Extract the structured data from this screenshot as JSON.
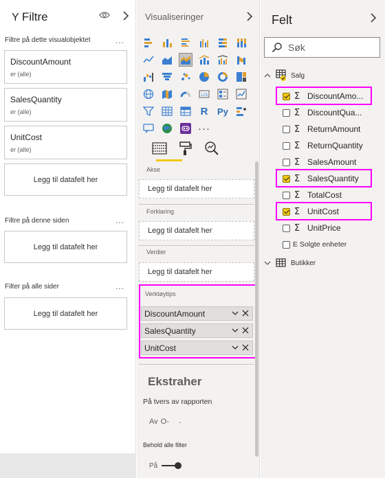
{
  "filters": {
    "title": "Filtre",
    "visual_section": "Filtre på dette visualobjektet",
    "page_section": "Filtre på denne siden",
    "all_section": "Filter på alle sider",
    "more": "...",
    "cards": [
      {
        "name": "DiscountAmount",
        "sub": "er (alle)"
      },
      {
        "name": "SalesQuantity",
        "sub": "er (alle)"
      },
      {
        "name": "UnitCost",
        "sub": "er (alle)"
      }
    ],
    "add_field": "Legg til datafelt her"
  },
  "visualizations": {
    "title": "Visualiseringer",
    "more_visuals": "···",
    "wells": {
      "axis": "Akse",
      "legend": "Forklaring",
      "values": "Verdier",
      "tooltips": "Verktøytips",
      "add_field": "Legg til datafelt her"
    },
    "tooltip_fields": [
      "DiscountAmount",
      "SalesQuantity",
      "UnitCost"
    ],
    "drillthrough": {
      "title": "Ekstraher",
      "cross_report": "På tvers av rapporten",
      "off_label": "Av",
      "off_symbol": "O-",
      "dot": "·",
      "keep_all": "Behold alle filter",
      "on_label": "På"
    },
    "icons": {
      "r": "R",
      "py": "Py"
    }
  },
  "fields": {
    "title": "Felt",
    "search_placeholder": "Søk",
    "tables": [
      {
        "name": "Salg",
        "expanded": true,
        "fields": [
          {
            "name": "DiscountAmo...",
            "checked": true,
            "sigma": true
          },
          {
            "name": "DiscountQua...",
            "checked": false,
            "sigma": true
          },
          {
            "name": "ReturnAmount",
            "checked": false,
            "sigma": true
          },
          {
            "name": "ReturnQuantity",
            "checked": false,
            "sigma": true
          },
          {
            "name": "SalesAmount",
            "checked": false,
            "sigma": true
          },
          {
            "name": "SalesQuantity",
            "checked": true,
            "sigma": true
          },
          {
            "name": "TotalCost",
            "checked": false,
            "sigma": true
          },
          {
            "name": "UnitCost",
            "checked": true,
            "sigma": true
          },
          {
            "name": "UnitPrice",
            "checked": false,
            "sigma": true
          },
          {
            "name": "E Solgte enheter",
            "checked": false,
            "sigma": false
          }
        ]
      },
      {
        "name": "Butikker",
        "expanded": false,
        "fields": []
      }
    ]
  },
  "colors": {
    "highlight": "#ff00ff",
    "accent": "#f2c811"
  }
}
